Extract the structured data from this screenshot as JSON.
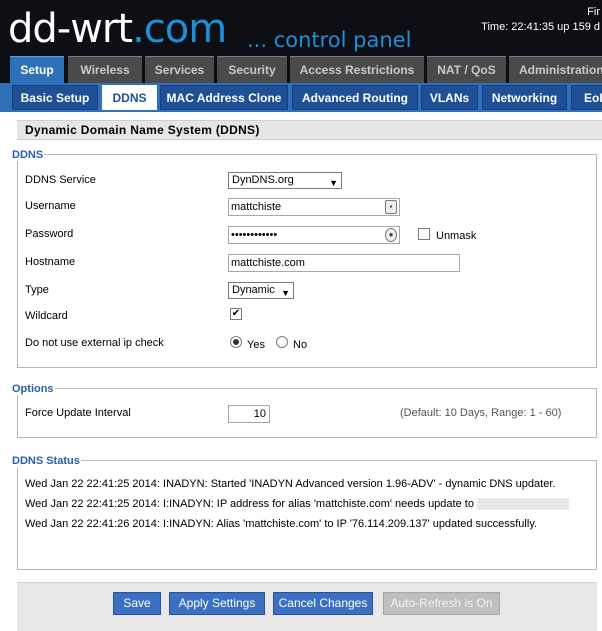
{
  "header": {
    "logo_main": "dd-wrt",
    "logo_com": ".com",
    "panel_title": "... control panel",
    "firmware_text": "Fir",
    "uptime_text": "Time: 22:41:35 up 159 d"
  },
  "main_tabs": [
    "Setup",
    "Wireless",
    "Services",
    "Security",
    "Access Restrictions",
    "NAT / QoS",
    "Administration"
  ],
  "sub_tabs": [
    "Basic Setup",
    "DDNS",
    "MAC Address Clone",
    "Advanced Routing",
    "VLANs",
    "Networking",
    "EoIP"
  ],
  "page_title": "Dynamic Domain Name System (DDNS)",
  "ddns": {
    "legend": "DDNS",
    "service_label": "DDNS Service",
    "service_value": "DynDNS.org",
    "username_label": "Username",
    "username_value": "mattchiste",
    "password_label": "Password",
    "password_value": "••••••••••••",
    "unmask_label": "Unmask",
    "hostname_label": "Hostname",
    "hostname_value": "mattchiste.com",
    "type_label": "Type",
    "type_value": "Dynamic",
    "wildcard_label": "Wildcard",
    "wildcard_checked": true,
    "extcheck_label": "Do not use external ip check",
    "yes_label": "Yes",
    "no_label": "No"
  },
  "options": {
    "legend": "Options",
    "force_label": "Force Update Interval",
    "force_value": "10",
    "force_hint": "(Default: 10 Days, Range: 1 - 60)"
  },
  "status": {
    "legend": "DDNS Status",
    "lines": [
      "Wed Jan 22 22:41:25 2014: INADYN: Started 'INADYN Advanced version 1.96-ADV' - dynamic DNS updater.",
      "Wed Jan 22 22:41:25 2014: I:INADYN: IP address for alias 'mattchiste.com' needs update to",
      "Wed Jan 22 22:41:26 2014: I:INADYN: Alias 'mattchiste.com' to IP '76.114.209.137' updated successfully."
    ]
  },
  "buttons": {
    "save": "Save",
    "apply": "Apply Settings",
    "cancel": "Cancel Changes",
    "autorefresh": "Auto-Refresh is On"
  }
}
